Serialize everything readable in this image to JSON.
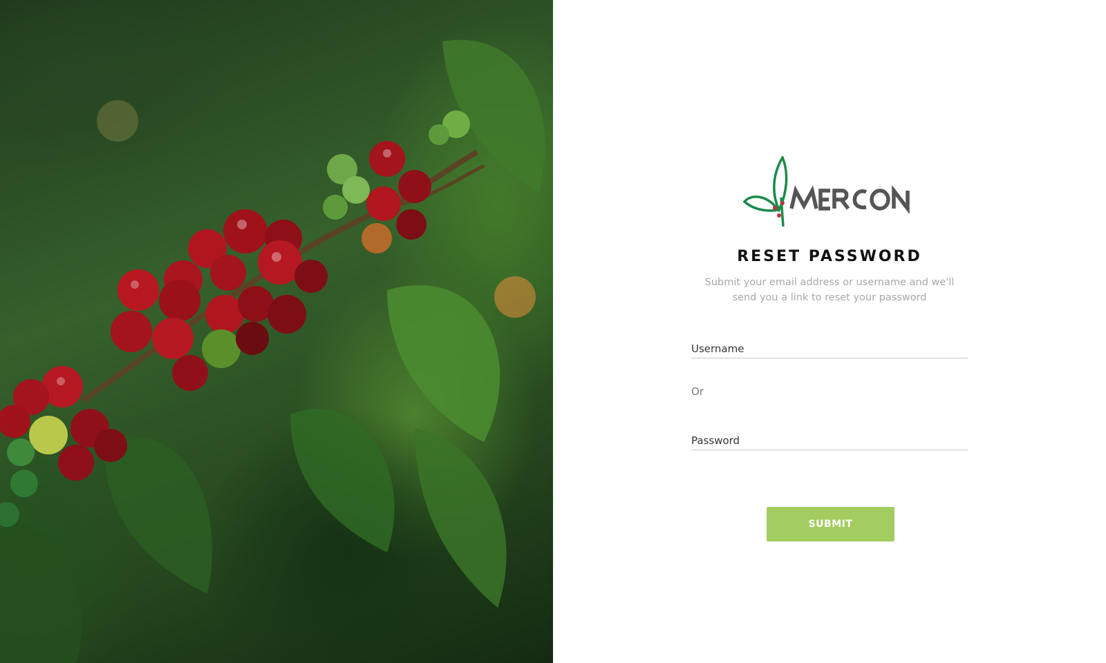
{
  "brand": {
    "name": "MERCON",
    "green": "#1a8a4a",
    "accent_red": "#c0303a"
  },
  "hero": {
    "icon": "coffee-cherries-photo"
  },
  "reset": {
    "title": "RESET PASSWORD",
    "subtitle": "Submit your email address or username and we'll send you a link to reset your password",
    "username_placeholder": "Username",
    "or_label": "Or",
    "password_placeholder": "Password",
    "submit_label": "SUBMIT"
  },
  "colors": {
    "submit_bg": "#a3cd61",
    "subtitle": "#a8a8a8",
    "underline": "#c9c9c9"
  }
}
